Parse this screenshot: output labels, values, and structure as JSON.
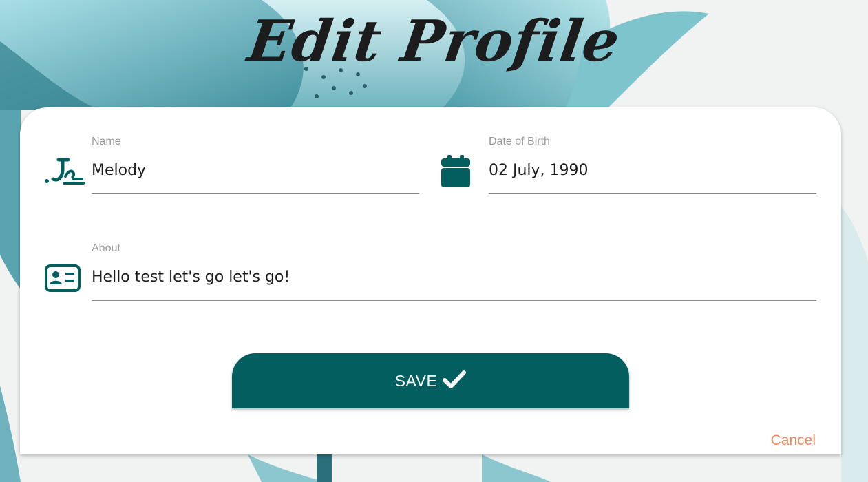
{
  "colors": {
    "accent": "#035e5f",
    "cancel": "#f08a5d",
    "label": "#9a9a9a",
    "card": "#ffffff"
  },
  "header": {
    "title": "Edit Profile"
  },
  "form": {
    "name": {
      "label": "Name",
      "value": "Melody",
      "icon": "signature-icon"
    },
    "dob": {
      "label": "Date of Birth",
      "value": "02 July, 1990",
      "icon": "calendar-icon"
    },
    "about": {
      "label": "About",
      "value": "Hello test let's go let's go!",
      "icon": "id-card-icon"
    }
  },
  "actions": {
    "save_label": "SAVE",
    "save_icon": "checkmark-icon",
    "cancel_label": "Cancel"
  }
}
